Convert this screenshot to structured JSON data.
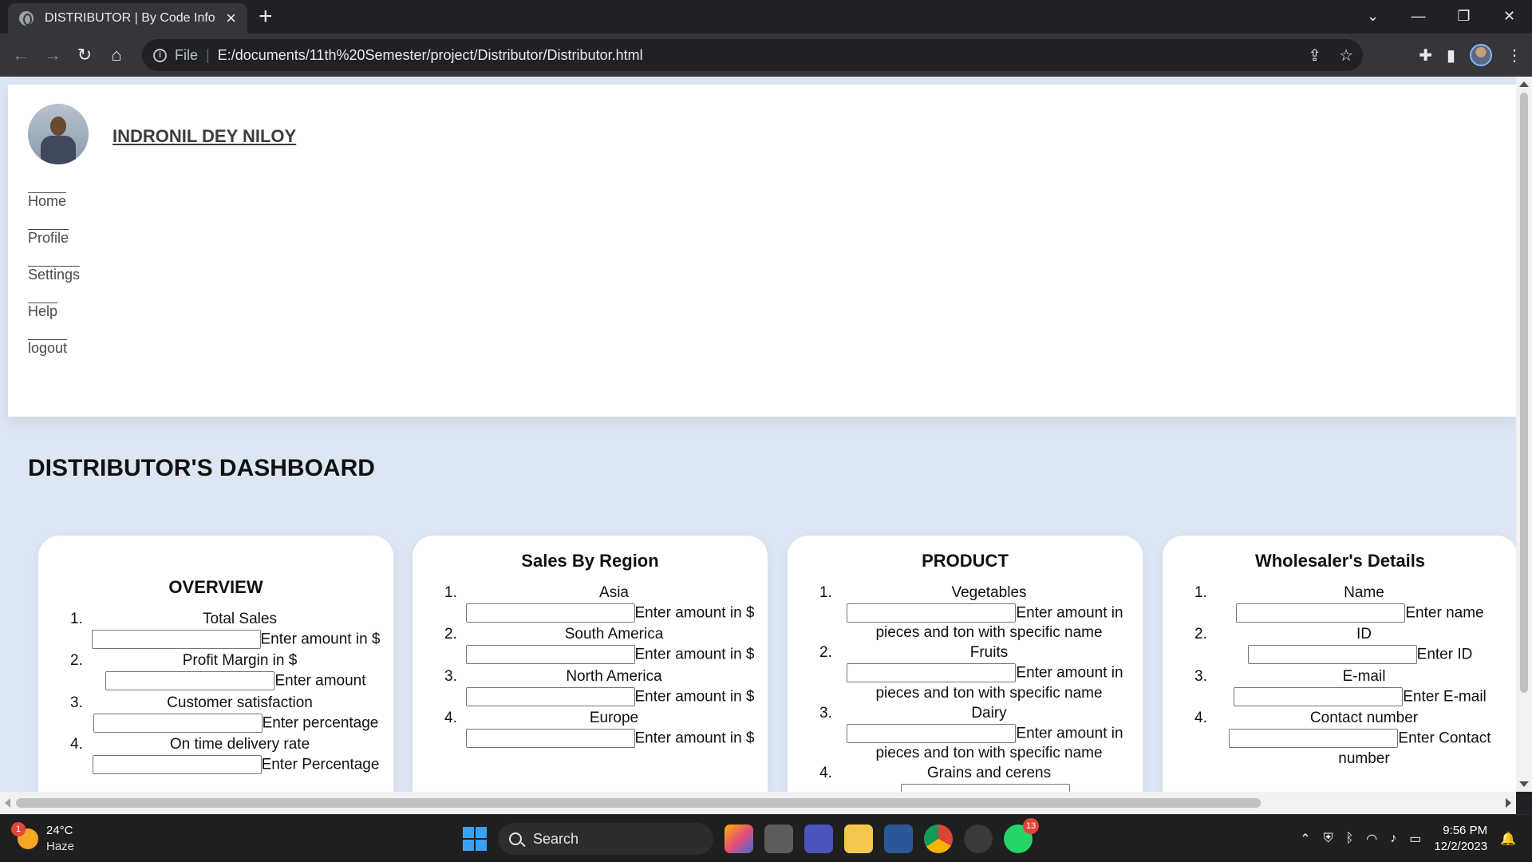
{
  "browser": {
    "tab_title": "DISTRIBUTOR | By Code Info",
    "url_scheme": "File",
    "url": "E:/documents/11th%20Semester/project/Distributor/Distributor.html"
  },
  "page": {
    "username": "INDRONIL DEY NILOY",
    "nav": [
      "Home",
      "Profile",
      "Settings",
      "Help",
      "logout"
    ],
    "dashboard_title": "DISTRIBUTOR'S DASHBOARD",
    "cards": [
      {
        "title": "OVERVIEW",
        "items": [
          {
            "num": "1.",
            "label": "Total Sales",
            "hint": "Enter amount in $"
          },
          {
            "num": "2.",
            "label": "Profit Margin in $",
            "hint": "Enter amount"
          },
          {
            "num": "3.",
            "label": "Customer satisfaction",
            "hint": "Enter percentage"
          },
          {
            "num": "4.",
            "label": "On time delivery rate",
            "hint": "Enter Percentage"
          }
        ]
      },
      {
        "title": "Sales By Region",
        "items": [
          {
            "num": "1.",
            "label": "Asia",
            "hint": "Enter amount in $"
          },
          {
            "num": "2.",
            "label": "South America",
            "hint": "Enter amount in $"
          },
          {
            "num": "3.",
            "label": "North America",
            "hint": "Enter amount in $"
          },
          {
            "num": "4.",
            "label": "Europe",
            "hint": "Enter amount in $"
          }
        ]
      },
      {
        "title": "PRODUCT",
        "items": [
          {
            "num": "1.",
            "label": "Vegetables",
            "hint": "Enter amount in",
            "hint2": "pieces and ton with specific name"
          },
          {
            "num": "2.",
            "label": "Fruits",
            "hint": "Enter amount in",
            "hint2": "pieces and ton with specific name"
          },
          {
            "num": "3.",
            "label": "Dairy",
            "hint": "Enter amount in",
            "hint2": "pieces and ton with specific name"
          },
          {
            "num": "4.",
            "label": "Grains and cerens",
            "hint": "",
            "hint2": ""
          }
        ]
      },
      {
        "title": "Wholesaler's Details",
        "items": [
          {
            "num": "1.",
            "label": "Name",
            "hint": "Enter name"
          },
          {
            "num": "2.",
            "label": "ID",
            "hint": "Enter ID"
          },
          {
            "num": "3.",
            "label": "E-mail",
            "hint": "Enter E-mail"
          },
          {
            "num": "4.",
            "label": "Contact number",
            "hint": "Enter Contact",
            "hint2": "number"
          }
        ]
      }
    ]
  },
  "taskbar": {
    "weather_badge": "1",
    "temperature": "24°C",
    "condition": "Haze",
    "search_label": "Search",
    "whatsapp_count": "13",
    "time": "9:56 PM",
    "date": "12/2/2023"
  }
}
